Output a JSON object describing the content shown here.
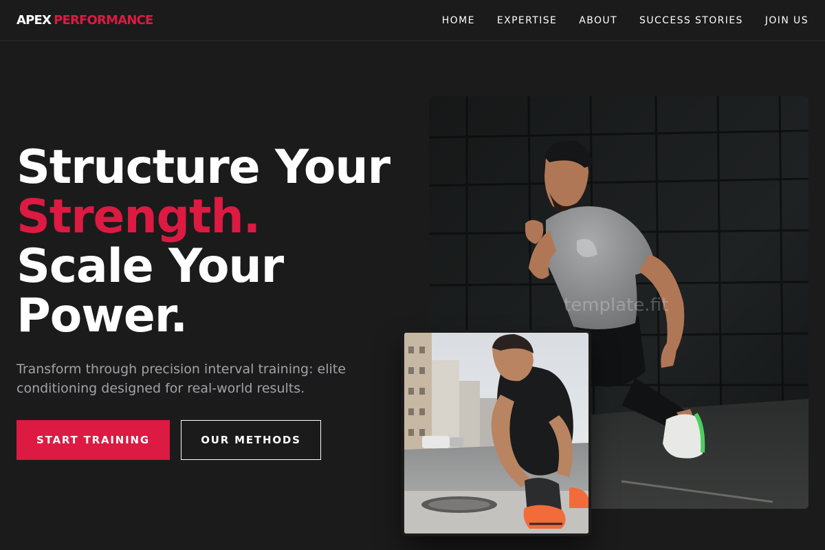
{
  "brand": {
    "name_part1": "APEX",
    "name_part2": "PERFORMANCE",
    "accent_color": "#dc1a42"
  },
  "nav": {
    "items": [
      {
        "label": "HOME"
      },
      {
        "label": "EXPERTISE"
      },
      {
        "label": "ABOUT"
      },
      {
        "label": "SUCCESS STORIES"
      },
      {
        "label": "JOIN US"
      }
    ]
  },
  "hero": {
    "title_line1": "Structure Your",
    "title_line2": "Strength.",
    "title_line3": "Scale Your",
    "title_line4": "Power.",
    "subtitle": "Transform through precision interval training: elite conditioning designed for real-world results.",
    "primary_button": "START TRAINING",
    "secondary_button": "OUR METHODS"
  },
  "images": {
    "main_photo": "athlete-lunge-photo",
    "inset_photo": "runner-tying-shoe-photo",
    "watermark": "template.fit"
  }
}
